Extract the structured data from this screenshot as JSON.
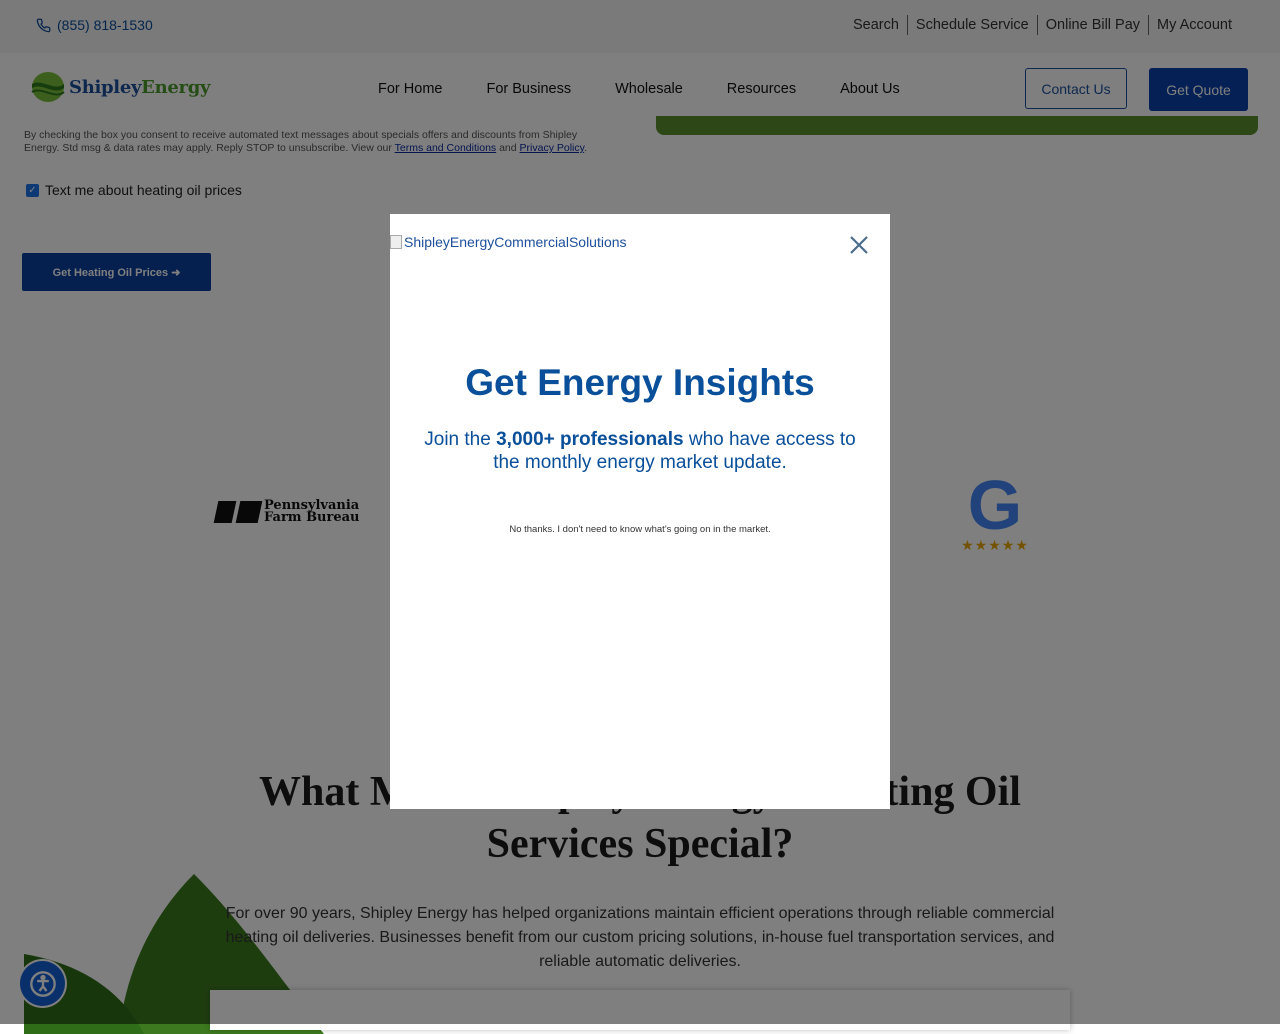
{
  "utility": {
    "phone": "(855) 818-1530",
    "links": [
      "Search",
      "Schedule Service",
      "Online Bill Pay",
      "My Account"
    ]
  },
  "nav": {
    "logo_word1": "Shipley",
    "logo_word2": "Energy",
    "menu": [
      "For Home",
      "For Business",
      "Wholesale",
      "Resources",
      "About Us"
    ],
    "contact_label": "Contact Us",
    "quote_label": "Get Quote"
  },
  "form": {
    "consent_text": "By checking the box you consent to receive automated text messages about specials offers and discounts from Shipley Energy. Std msg & data rates may apply. Reply STOP to unsubscribe. View our",
    "terms_link": "Terms and Conditions",
    "and_text": "and",
    "privacy_link": "Privacy Policy",
    "checkbox_label": "Text me about heating oil prices",
    "checkbox_checked": true,
    "submit_label": "Get Heating Oil Prices ➜"
  },
  "logos": {
    "pfb_line1": "Pennsylvania",
    "pfb_line2": "Farm Bureau",
    "google_letter": "G",
    "google_stars": "★★★★★"
  },
  "section": {
    "heading": "What Makes Shipley Energy's Heating Oil Services Special?",
    "paragraph": "For over 90 years, Shipley Energy has helped organizations maintain efficient operations through reliable commercial heating oil deliveries. Businesses benefit from our custom pricing solutions, in-house fuel transportation services, and reliable automatic deliveries."
  },
  "modal": {
    "image_alt": "ShipleyEnergyCommercialSolutions",
    "title": "Get Energy Insights",
    "sub_pre": "Join the ",
    "sub_bold": "3,000+ professionals",
    "sub_post": " who have access to the monthly energy market update.",
    "decline": "No thanks. I don't need to know what's going on in the market."
  },
  "colors": {
    "brand_blue": "#0b40a8",
    "brand_green": "#4c9a2a",
    "modal_text": "#0a4f9a"
  }
}
